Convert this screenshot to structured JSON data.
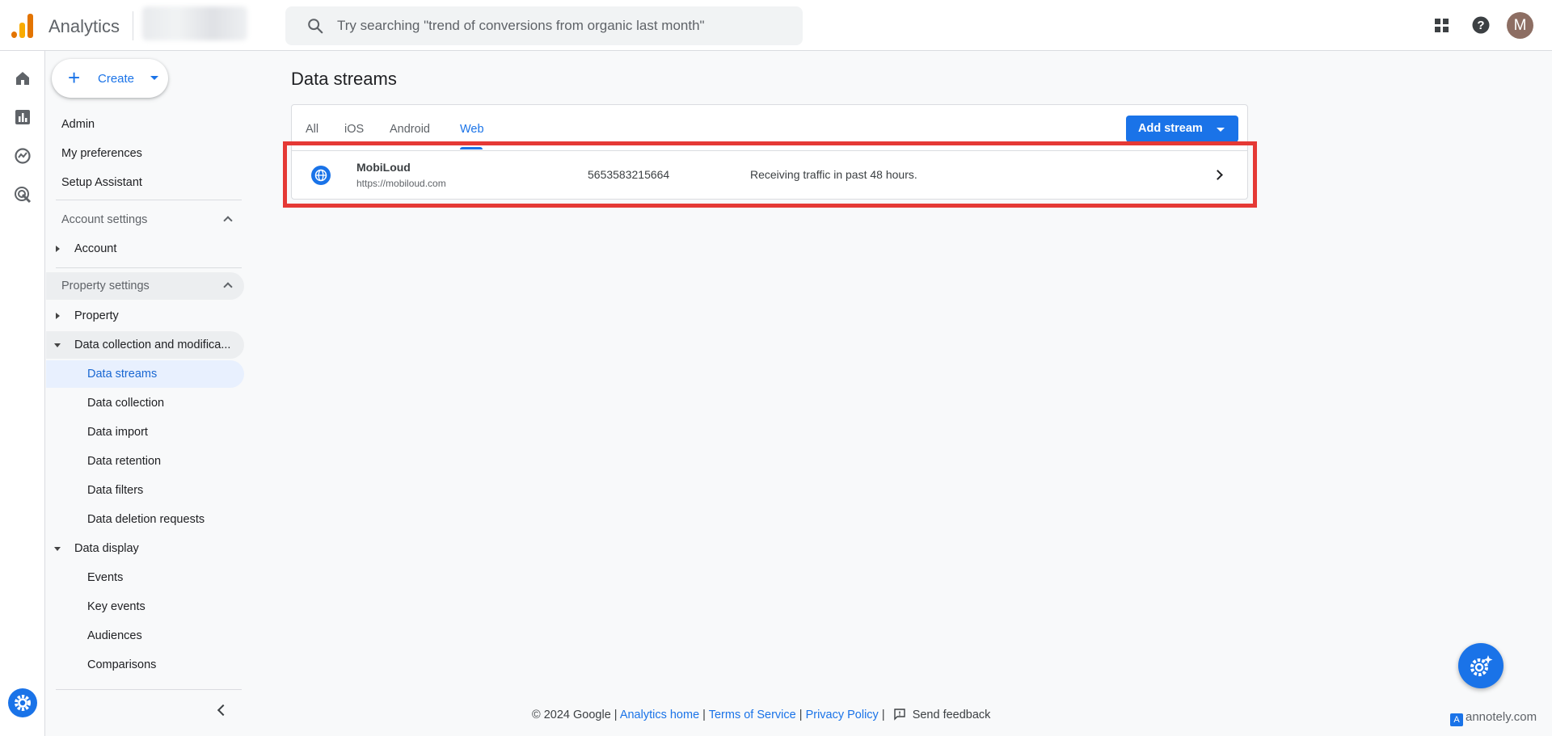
{
  "app": {
    "name": "Analytics",
    "search_placeholder": "Try searching \"trend of conversions from organic last month\"",
    "avatar_initial": "M"
  },
  "sidebar": {
    "create_label": "Create",
    "items_top": [
      "Admin",
      "My preferences",
      "Setup Assistant"
    ],
    "account_settings": {
      "label": "Account settings",
      "children": [
        "Account"
      ]
    },
    "property_settings": {
      "label": "Property settings",
      "property": "Property",
      "data_collection_group": "Data collection and modifica...",
      "data_collection_items": [
        "Data streams",
        "Data collection",
        "Data import",
        "Data retention",
        "Data filters",
        "Data deletion requests"
      ],
      "data_display_group": "Data display",
      "data_display_items": [
        "Events",
        "Key events",
        "Audiences",
        "Comparisons"
      ]
    }
  },
  "main": {
    "title": "Data streams",
    "tabs": [
      "All",
      "iOS",
      "Android",
      "Web"
    ],
    "active_tab": "Web",
    "add_stream_label": "Add stream",
    "streams": [
      {
        "name": "MobiLoud",
        "url": "https://mobiloud.com",
        "stream_id": "5653583215664",
        "status": "Receiving traffic in past 48 hours."
      }
    ]
  },
  "footer": {
    "copyright": "© 2024 Google",
    "analytics_home": "Analytics home",
    "terms": "Terms of Service",
    "privacy": "Privacy Policy",
    "send_feedback": "Send feedback",
    "separator": "|"
  },
  "watermark": "annotely.com",
  "colors": {
    "accent": "#1a73e8",
    "highlight": "#e53935",
    "active_bg": "#e8f0fe"
  }
}
